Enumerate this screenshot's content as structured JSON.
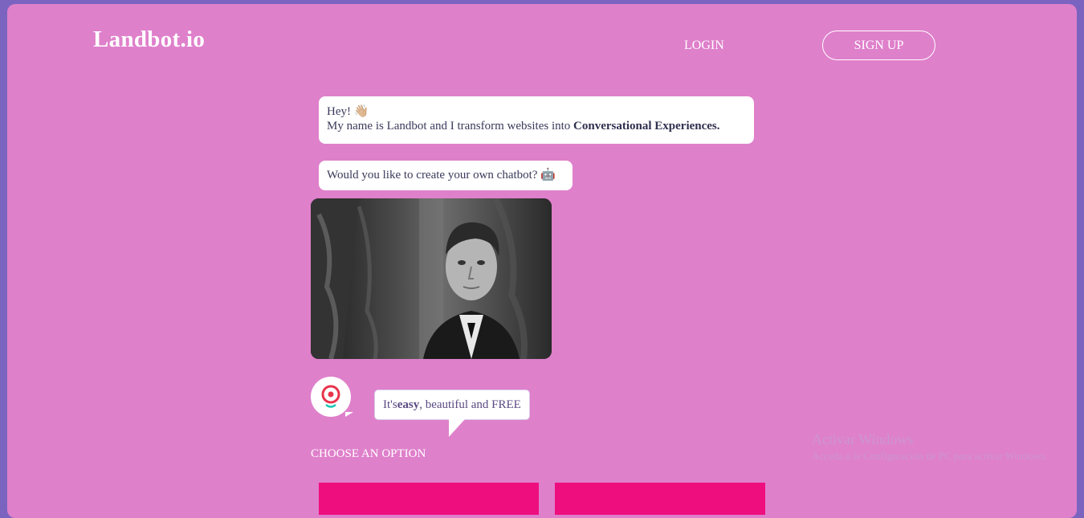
{
  "header": {
    "logo": "Landbot.io",
    "login_label": "LOGIN",
    "signup_label": "SIGN UP"
  },
  "chat": {
    "greeting_line1": "Hey! 👋🏼",
    "greeting_line2_prefix": "My name is Landbot and I transform websites into ",
    "greeting_line2_bold": "Conversational Experiences.",
    "question": "Would you like to create your own chatbot? 🤖",
    "tip_prefix": "It's ",
    "tip_bold": "easy",
    "tip_suffix": ", beautiful and FREE",
    "choose_label": "CHOOSE AN OPTION"
  },
  "watermark": {
    "title": "Activar Windows",
    "subtitle": "Acceda a la Configuración de PC para activar Windows."
  },
  "colors": {
    "page_background": "#df80cb",
    "frame_border": "#7b63c0",
    "option_button": "#ee0e7e",
    "avatar_icon": "#e8334a",
    "avatar_smile": "#1ec6b3"
  },
  "icons": {
    "avatar": "landbot-avatar-icon"
  }
}
